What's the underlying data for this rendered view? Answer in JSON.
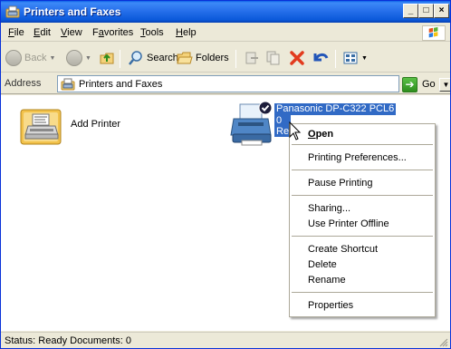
{
  "window": {
    "title": "Printers and Faxes"
  },
  "menubar": {
    "items": [
      {
        "label": "File",
        "accel": "F"
      },
      {
        "label": "Edit",
        "accel": "E"
      },
      {
        "label": "View",
        "accel": "V"
      },
      {
        "label": "Favorites",
        "accel": "a"
      },
      {
        "label": "Tools",
        "accel": "T"
      },
      {
        "label": "Help",
        "accel": "H"
      }
    ]
  },
  "toolbar": {
    "back_label": "Back",
    "search_label": "Search",
    "folders_label": "Folders"
  },
  "address": {
    "label": "Address",
    "value": "Printers and Faxes",
    "go_label": "Go"
  },
  "content": {
    "add_printer_label": "Add Printer",
    "printer_label_line1": "Panasonic DP-C322 PCL6",
    "printer_label_line2a": "0",
    "printer_label_line2b": "Re"
  },
  "context_menu": {
    "open": "Open",
    "printing_preferences": "Printing Preferences...",
    "pause_printing": "Pause Printing",
    "sharing": "Sharing...",
    "use_printer_offline": "Use Printer Offline",
    "create_shortcut": "Create Shortcut",
    "delete": "Delete",
    "rename": "Rename",
    "properties": "Properties"
  },
  "status": {
    "text": "Status: Ready Documents: 0"
  },
  "icons": {
    "title_icon": "printers-folder-icon",
    "back_icon": "back-arrow-icon",
    "forward_icon": "forward-arrow-icon",
    "up_icon": "up-folder-icon",
    "search_icon": "search-icon",
    "folders_icon": "folders-icon",
    "delete_icon": "delete-x-icon",
    "undo_icon": "undo-icon",
    "views_icon": "views-icon"
  },
  "colors": {
    "titlebar": "#0A58D9",
    "selection": "#316AC5",
    "window_bg": "#ECE9D8"
  }
}
